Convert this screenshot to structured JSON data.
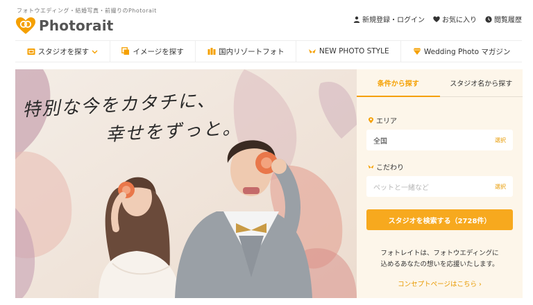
{
  "header": {
    "tagline": "フォトウエディング・結婚写真・前撮りのPhotorait",
    "logo_text": "Photorait",
    "brand_color": "#f5a000"
  },
  "util_nav": [
    {
      "label": "新規登録・ログイン",
      "icon": "user-icon"
    },
    {
      "label": "お気に入り",
      "icon": "heart-icon"
    },
    {
      "label": "閲覧履歴",
      "icon": "clock-icon"
    }
  ],
  "main_nav": [
    {
      "label": "スタジオを探す",
      "icon": "studio-icon",
      "dropdown": true
    },
    {
      "label": "イメージを探す",
      "icon": "images-icon"
    },
    {
      "label": "国内リゾートフォト",
      "icon": "resort-icon"
    },
    {
      "label": "NEW PHOTO STYLE",
      "icon": "ribbon-icon"
    },
    {
      "label": "Wedding Photo マガジン",
      "icon": "diamond-icon"
    }
  ],
  "hero": {
    "line1": "特別な今をカタチに、",
    "line2": "幸せをずっと。"
  },
  "search": {
    "tabs": [
      {
        "label": "条件から探す",
        "active": true
      },
      {
        "label": "スタジオ名から探す",
        "active": false
      }
    ],
    "area_label": "エリア",
    "area_value": "全国",
    "area_select": "選択",
    "kodawari_label": "こだわり",
    "kodawari_placeholder": "ペットと一緒など",
    "kodawari_select": "選択",
    "button_label": "スタジオを検索する（2728件）",
    "description_line1": "フォトレイトは、フォトウエディングに",
    "description_line2": "込めるあなたの想いを応援いたします。",
    "concept_link": "コンセプトページはこちら ›",
    "accent_color": "#f7a91e",
    "panel_bg": "#fdf6ea"
  }
}
